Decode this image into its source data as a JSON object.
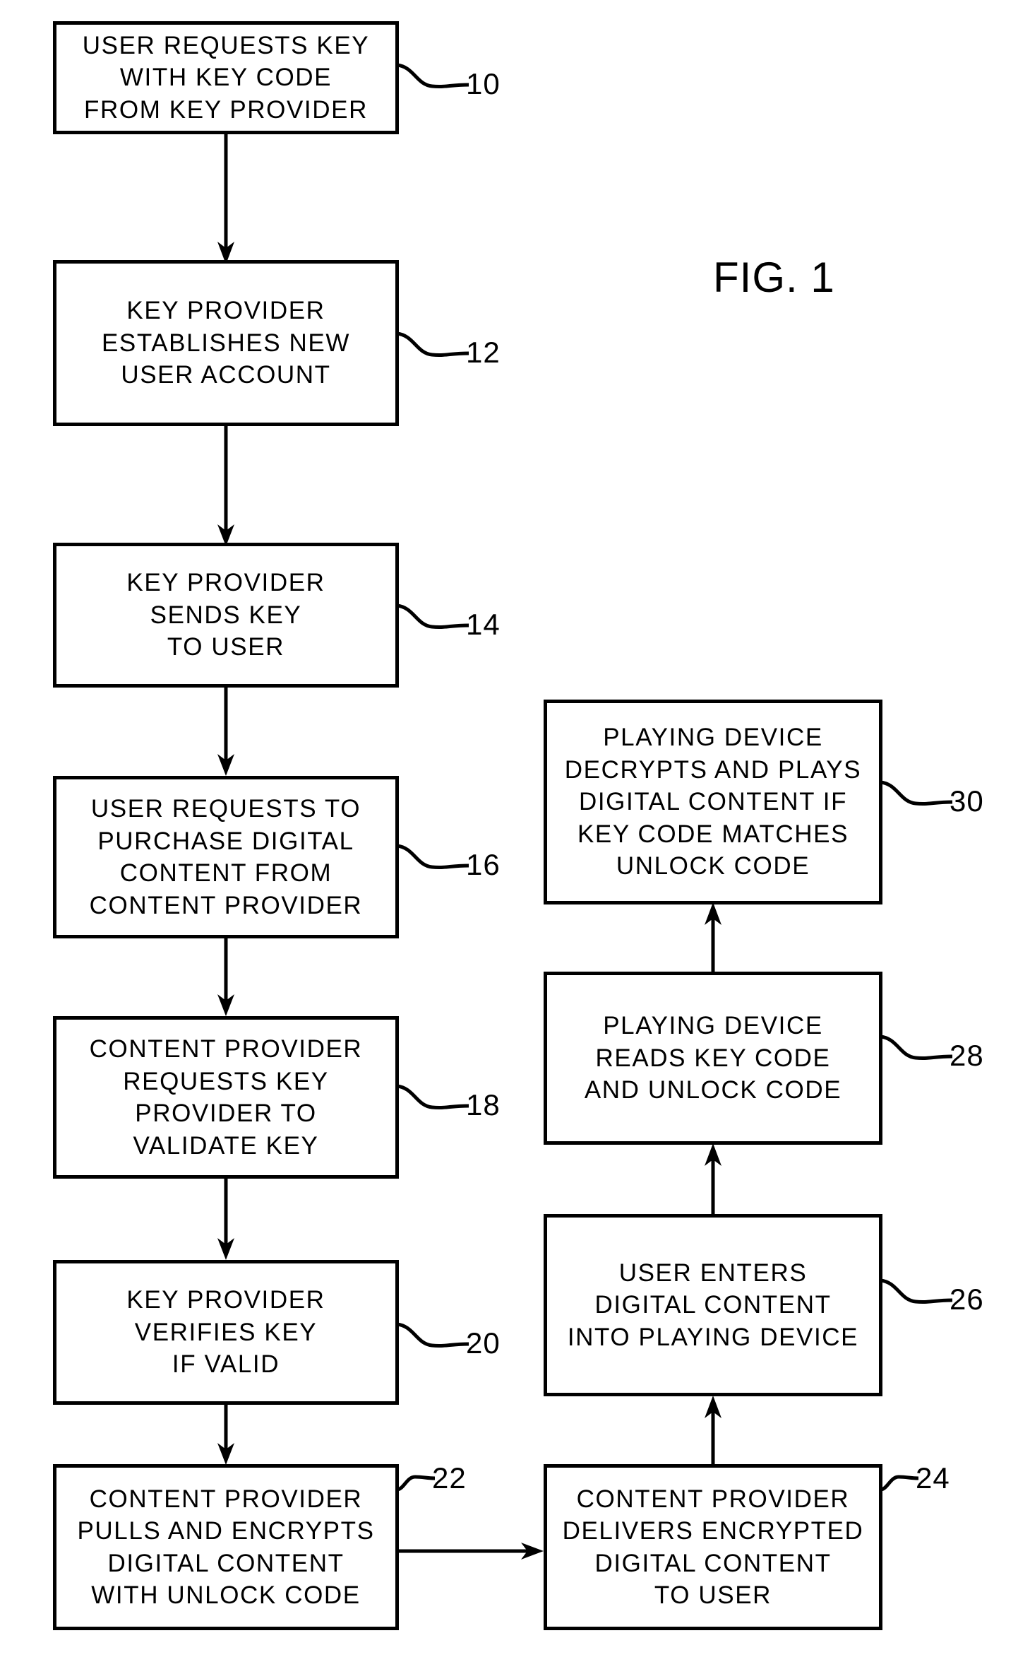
{
  "figure": {
    "title": "FIG. 1",
    "type": "process-flowchart",
    "line_color": "#000000",
    "background_color": "#ffffff"
  },
  "nodes": [
    {
      "ref": "10",
      "lines": [
        "USER REQUESTS KEY",
        "WITH  KEY CODE",
        "FROM  KEY PROVIDER"
      ]
    },
    {
      "ref": "12",
      "lines": [
        "KEY PROVIDER",
        "ESTABLISHES NEW",
        "USER ACCOUNT"
      ]
    },
    {
      "ref": "14",
      "lines": [
        "KEY PROVIDER",
        "SENDS KEY",
        "TO USER"
      ]
    },
    {
      "ref": "16",
      "lines": [
        "USER REQUESTS TO",
        "PURCHASE DIGITAL",
        "CONTENT FROM",
        "CONTENT PROVIDER"
      ]
    },
    {
      "ref": "18",
      "lines": [
        "CONTENT PROVIDER",
        "REQUESTS KEY",
        "PROVIDER TO",
        "VALIDATE KEY"
      ]
    },
    {
      "ref": "20",
      "lines": [
        "KEY PROVIDER",
        "VERIFIES KEY",
        "IF VALID"
      ]
    },
    {
      "ref": "22",
      "lines": [
        "CONTENT PROVIDER",
        "PULLS AND  ENCRYPTS",
        "DIGITAL CONTENT",
        "WITH  UNLOCK CODE"
      ]
    },
    {
      "ref": "24",
      "lines": [
        "CONTENT PROVIDER",
        "DELIVERS ENCRYPTED",
        "DIGITAL CONTENT",
        "TO USER"
      ]
    },
    {
      "ref": "26",
      "lines": [
        "USER ENTERS",
        "DIGITAL CONTENT",
        "INTO PLAYING DEVICE"
      ]
    },
    {
      "ref": "28",
      "lines": [
        "PLAYING DEVICE",
        "READS KEY CODE",
        "AND UNLOCK CODE"
      ]
    },
    {
      "ref": "30",
      "lines": [
        "PLAYING DEVICE",
        "DECRYPTS AND PLAYS",
        "DIGITAL CONTENT IF",
        "KEY CODE MATCHES",
        "UNLOCK CODE"
      ]
    }
  ]
}
